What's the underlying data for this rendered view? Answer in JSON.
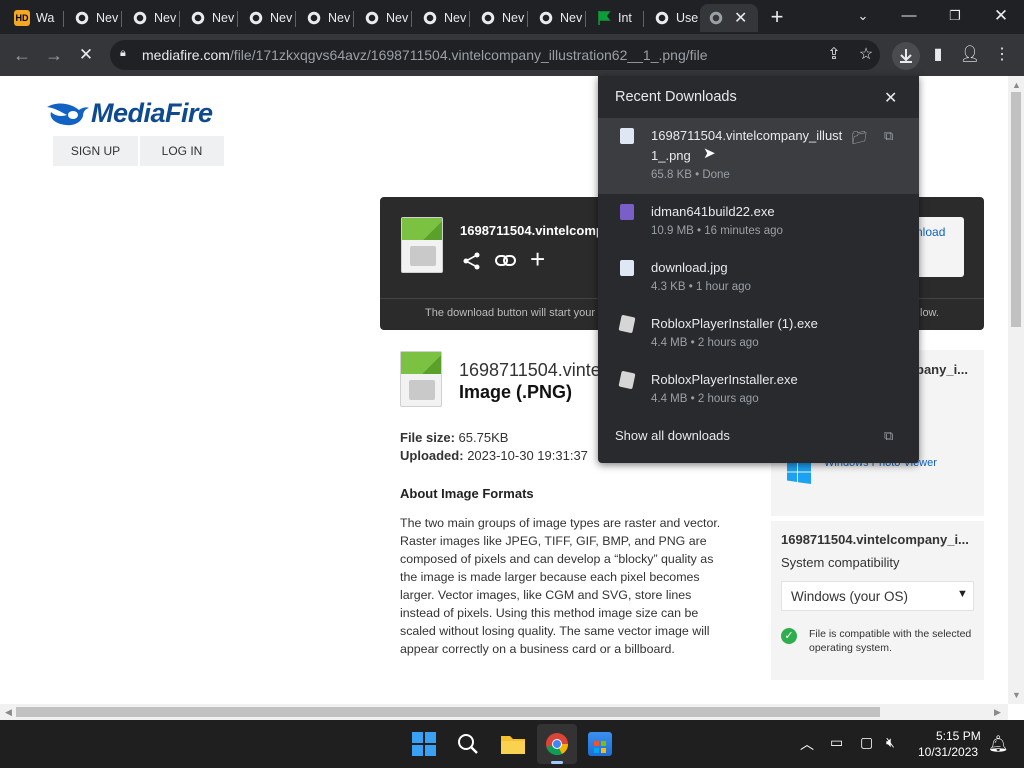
{
  "tabs": [
    {
      "title": "Wa",
      "icon": "hd-icon"
    },
    {
      "title": "Nev",
      "icon": "chrome-icon"
    },
    {
      "title": "Nev",
      "icon": "chrome-icon"
    },
    {
      "title": "Nev",
      "icon": "chrome-icon"
    },
    {
      "title": "Nev",
      "icon": "chrome-icon"
    },
    {
      "title": "Nev",
      "icon": "chrome-icon"
    },
    {
      "title": "Nev",
      "icon": "chrome-icon"
    },
    {
      "title": "Nev",
      "icon": "chrome-icon"
    },
    {
      "title": "Nev",
      "icon": "chrome-icon"
    },
    {
      "title": "Nev",
      "icon": "chrome-icon"
    },
    {
      "title": "Int",
      "icon": "flag-icon"
    },
    {
      "title": "Use",
      "icon": "chrome-icon"
    }
  ],
  "address_bar": {
    "domain": "mediafire.com",
    "path": "/file/171zkxqgvs64avz/1698711504.vintelcompany_illustration62__1_.png/file"
  },
  "page": {
    "logo": "MediaFire",
    "sign_up": "SIGN UP",
    "log_in": "LOG IN",
    "dl_filename": "1698711504.vintelcompa",
    "dl_button": "nload",
    "dl_notice_left": "The download button will start your",
    "dl_notice_right": "low.",
    "file_name": "1698711504.vinte",
    "file_type": "Image (.PNG)",
    "file_size_label": "File size:",
    "file_size": "65.75KB",
    "uploaded_label": "Uploaded:",
    "uploaded": "2023-10-30 19:31:37",
    "about_heading": "About Image Formats",
    "about_text": "The two main groups of image types are raster and vector. Raster images like JPEG, TIFF, GIF, BMP, and PNG are composed of pixels and can develop a “blocky” quality as the image is made larger because each pixel becomes larger. Vector images, like CGM and SVG, store lines instead of pixels. Using this method image size can be scaled without losing quality. The same vector image will appear correctly on a business card or a billboard.",
    "sidebar_title_1": "pany_i...",
    "sidebar_app": "Windows Photo Viewer",
    "sidebar_title_2": "1698711504.vintelcompany_i...",
    "system_compat": "System compatibility",
    "os_selected": "Windows (your OS)",
    "compat_msg": "File is compatible with the selected operating system."
  },
  "downloads": {
    "title": "Recent Downloads",
    "show_all": "Show all downloads",
    "items": [
      {
        "name": "1698711504.vintelcompany_illust",
        "name2": "1_.png",
        "status": "65.8 KB • Done",
        "icon": "image-file-icon"
      },
      {
        "name": "idman641build22.exe",
        "status": "10.9 MB • 16 minutes ago",
        "icon": "exe-file-icon"
      },
      {
        "name": "download.jpg",
        "status": "4.3 KB • 1 hour ago",
        "icon": "image-file-icon"
      },
      {
        "name": "RobloxPlayerInstaller (1).exe",
        "status": "4.4 MB • 2 hours ago",
        "icon": "roblox-icon"
      },
      {
        "name": "RobloxPlayerInstaller.exe",
        "status": "4.4 MB • 2 hours ago",
        "icon": "roblox-icon"
      }
    ]
  },
  "taskbar": {
    "time": "5:15 PM",
    "date": "10/31/2023"
  },
  "colors": {
    "accent": "#0e4a8f",
    "chrome_dark": "#202124",
    "green": "#7cc242"
  }
}
